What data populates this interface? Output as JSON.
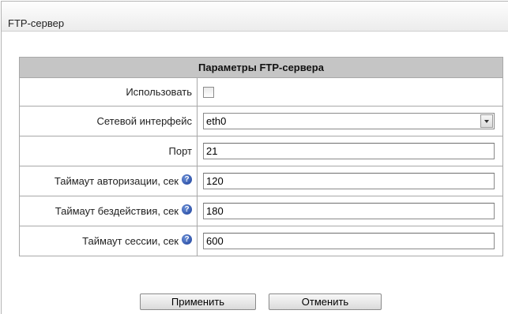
{
  "panel": {
    "title": "FTP-сервер"
  },
  "params": {
    "header": "Параметры FTP-сервера",
    "use_label": "Использовать",
    "use_checked": false,
    "iface_label": "Сетевой интерфейс",
    "iface_value": "eth0",
    "port_label": "Порт",
    "port_value": "21",
    "auth_timeout_label": "Таймаут авторизации, сек",
    "auth_timeout_value": "120",
    "idle_timeout_label": "Таймаут бездействия, сек",
    "idle_timeout_value": "180",
    "session_timeout_label": "Таймаут сессии, сек",
    "session_timeout_value": "600",
    "help_glyph": "?"
  },
  "buttons": {
    "apply": "Применить",
    "cancel": "Отменить"
  },
  "icons": [
    "help-icon",
    "chevron-down-icon"
  ]
}
